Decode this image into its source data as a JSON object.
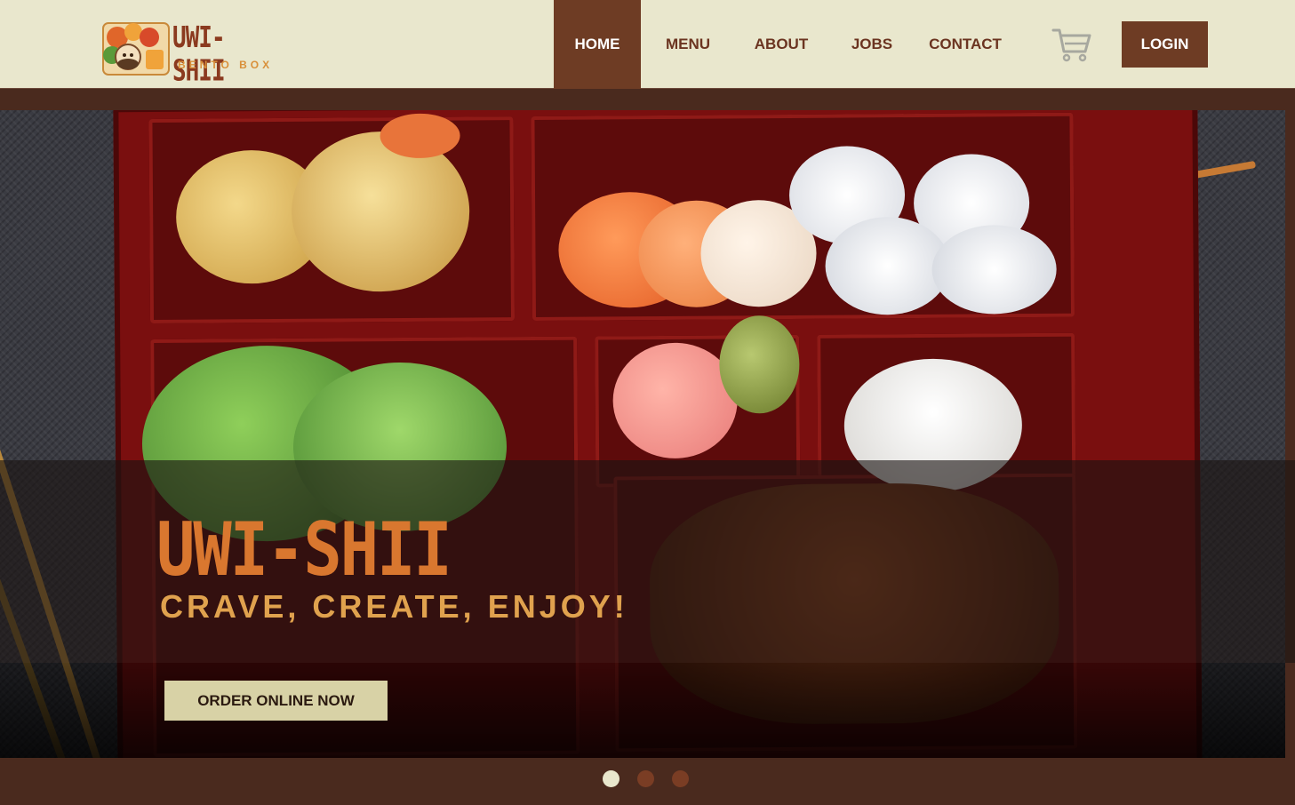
{
  "brand": {
    "name": "UWI-SHII",
    "subtitle": "BENTO BOX"
  },
  "nav": {
    "items": [
      {
        "label": "HOME",
        "active": true
      },
      {
        "label": "MENU",
        "active": false
      },
      {
        "label": "ABOUT",
        "active": false
      },
      {
        "label": "JOBS",
        "active": false
      },
      {
        "label": "CONTACT",
        "active": false
      }
    ],
    "cart_icon": "shopping-cart-icon",
    "login_label": "LOGIN"
  },
  "hero": {
    "title": "UWI-SHII",
    "tagline": "CRAVE, CREATE, ENJOY!",
    "cta_label": "ORDER ONLINE NOW",
    "slides_total": 3,
    "active_slide": 1
  },
  "colors": {
    "header_bg": "#e9e7cd",
    "brand_brown": "#6e3c24",
    "accent_orange": "#d9772f",
    "cta_bg": "#d8d2a6"
  }
}
